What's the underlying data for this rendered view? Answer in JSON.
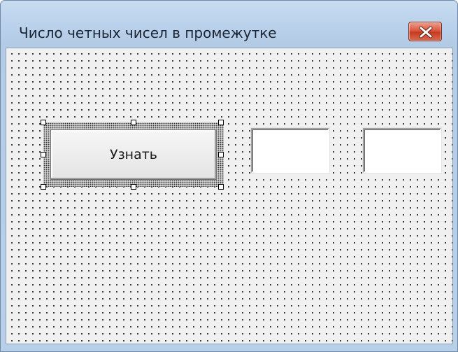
{
  "window": {
    "title": "Число четных чисел в промежутке",
    "close_icon": "close-icon"
  },
  "form": {
    "button_label": "Узнать",
    "textbox1": {
      "value": ""
    },
    "textbox2": {
      "value": ""
    }
  },
  "colors": {
    "titlebar": "#bcd3ec",
    "close_button": "#c63b22",
    "form_background": "#f0f0f0",
    "grid_dots": "#1a1a1a"
  }
}
